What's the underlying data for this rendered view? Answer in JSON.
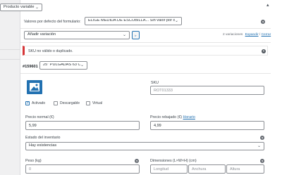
{
  "product_type": {
    "value": "Producto variable"
  },
  "defaults": {
    "label": "Valores por defecto del formulario:",
    "value": "ELIGE MEDIDA DE ESCOBILLA... Sin valor por defecto"
  },
  "add_variation": {
    "select_value": "Añadir variación",
    "go_label": "Ir"
  },
  "pagination": {
    "count": "2 variaciones",
    "expand": "Expandir",
    "separator": "/",
    "close": "Cerrar"
  },
  "error_notice": {
    "text": "SKU no válido o duplicado."
  },
  "variation": {
    "id": "#159601",
    "attribute_value": "25\" PULGADAS 63 CM",
    "sku": {
      "label": "SKU",
      "placeholder": "ROT01333"
    },
    "checkboxes": [
      {
        "label": "Activado",
        "checked": true
      },
      {
        "label": "Descargable",
        "checked": false
      },
      {
        "label": "Virtual",
        "checked": false
      }
    ],
    "regular_price": {
      "label": "Precio normal (€)",
      "value": "5,99"
    },
    "sale_price": {
      "label": "Precio rebajado (€)",
      "schedule_link": "Horario",
      "value": "4,99"
    },
    "stock_status": {
      "label": "Estado del inventario",
      "value": "Hay existencias"
    },
    "weight": {
      "label": "Peso (kg)",
      "placeholder": "0"
    },
    "dimensions": {
      "label": "Dimensiones (L×W×H) (cm)",
      "length_placeholder": "Longitud",
      "width_placeholder": "Anchura",
      "height_placeholder": "Altura"
    }
  },
  "colors": {
    "accent": "#2271b1",
    "error": "#d63638",
    "image_icon": "#2271b1"
  }
}
